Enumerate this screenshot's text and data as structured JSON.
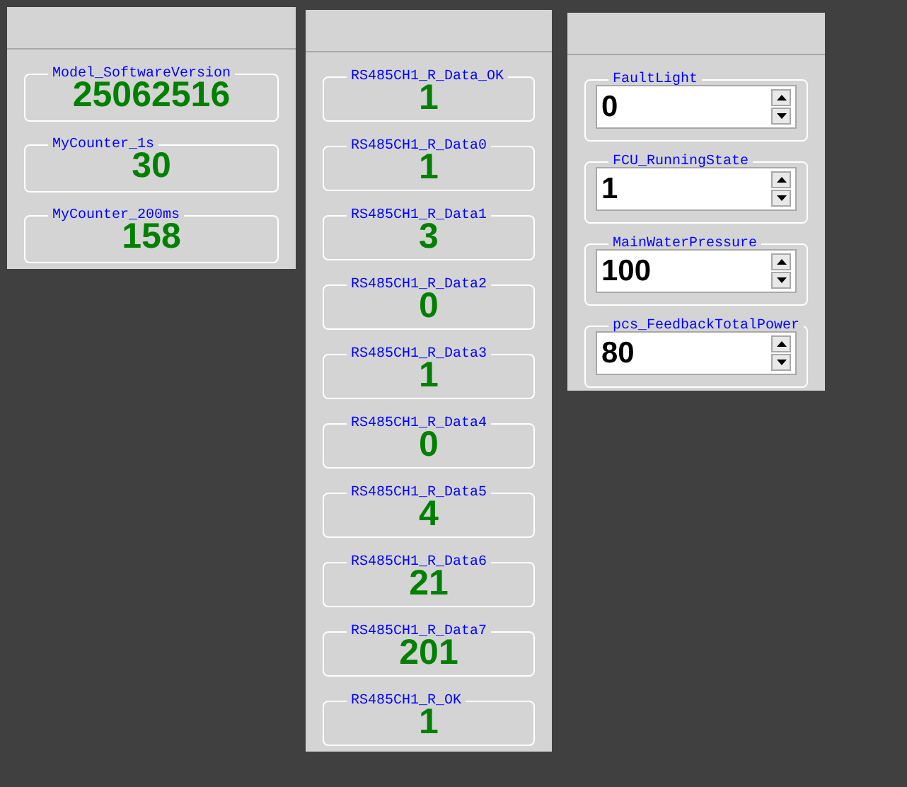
{
  "panels": [
    {
      "kind": "display",
      "fields": [
        {
          "label": "Model_SoftwareVersion",
          "value": "25062516"
        },
        {
          "label": "MyCounter_1s",
          "value": "30"
        },
        {
          "label": "MyCounter_200ms",
          "value": "158"
        }
      ]
    },
    {
      "kind": "display",
      "fields": [
        {
          "label": "RS485CH1_R_Data_OK",
          "value": "1"
        },
        {
          "label": "RS485CH1_R_Data0",
          "value": "1"
        },
        {
          "label": "RS485CH1_R_Data1",
          "value": "3"
        },
        {
          "label": "RS485CH1_R_Data2",
          "value": "0"
        },
        {
          "label": "RS485CH1_R_Data3",
          "value": "1"
        },
        {
          "label": "RS485CH1_R_Data4",
          "value": "0"
        },
        {
          "label": "RS485CH1_R_Data5",
          "value": "4"
        },
        {
          "label": "RS485CH1_R_Data6",
          "value": "21"
        },
        {
          "label": "RS485CH1_R_Data7",
          "value": "201"
        },
        {
          "label": "RS485CH1_R_OK",
          "value": "1"
        }
      ]
    },
    {
      "kind": "spinner",
      "fields": [
        {
          "label": "FaultLight",
          "value": "0"
        },
        {
          "label": "FCU_RunningState",
          "value": "1"
        },
        {
          "label": "MainWaterPressure",
          "value": "100"
        },
        {
          "label": "pcs_FeedbackTotalPower",
          "value": "80"
        }
      ]
    }
  ]
}
